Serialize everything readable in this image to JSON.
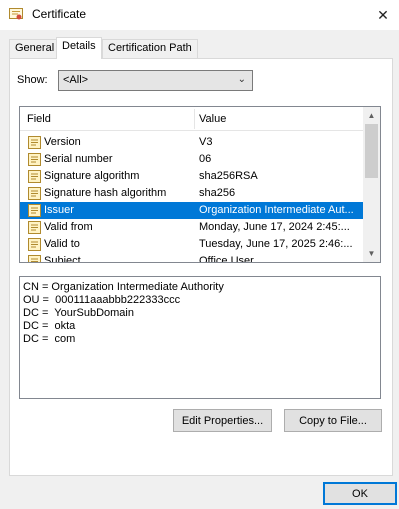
{
  "window": {
    "title": "Certificate",
    "close_glyph": "✕"
  },
  "tabs": [
    {
      "label": "General"
    },
    {
      "label": "Details"
    },
    {
      "label": "Certification Path"
    }
  ],
  "show": {
    "label": "Show:",
    "selected": "<All>"
  },
  "list": {
    "columns": {
      "field": "Field",
      "value": "Value"
    },
    "rows": [
      {
        "field": "Version",
        "value": "V3"
      },
      {
        "field": "Serial number",
        "value": "06"
      },
      {
        "field": "Signature algorithm",
        "value": "sha256RSA"
      },
      {
        "field": "Signature hash algorithm",
        "value": "sha256"
      },
      {
        "field": "Issuer",
        "value": "Organization Intermediate Aut...",
        "selected": true
      },
      {
        "field": "Valid from",
        "value": "Monday, June 17, 2024 2:45:..."
      },
      {
        "field": "Valid to",
        "value": "Tuesday, June 17, 2025 2:46:..."
      },
      {
        "field": "Subject",
        "value": "Office User"
      }
    ]
  },
  "detail_text": "CN = Organization Intermediate Authority\nOU =  000111aaabbb222333ccc\nDC =  YourSubDomain\nDC =  okta\nDC =  com",
  "buttons": {
    "edit_properties": "Edit Properties...",
    "copy_to_file": "Copy to File...",
    "ok": "OK"
  },
  "colors": {
    "selection": "#0078d7",
    "window_bg": "#f0f0f0"
  }
}
